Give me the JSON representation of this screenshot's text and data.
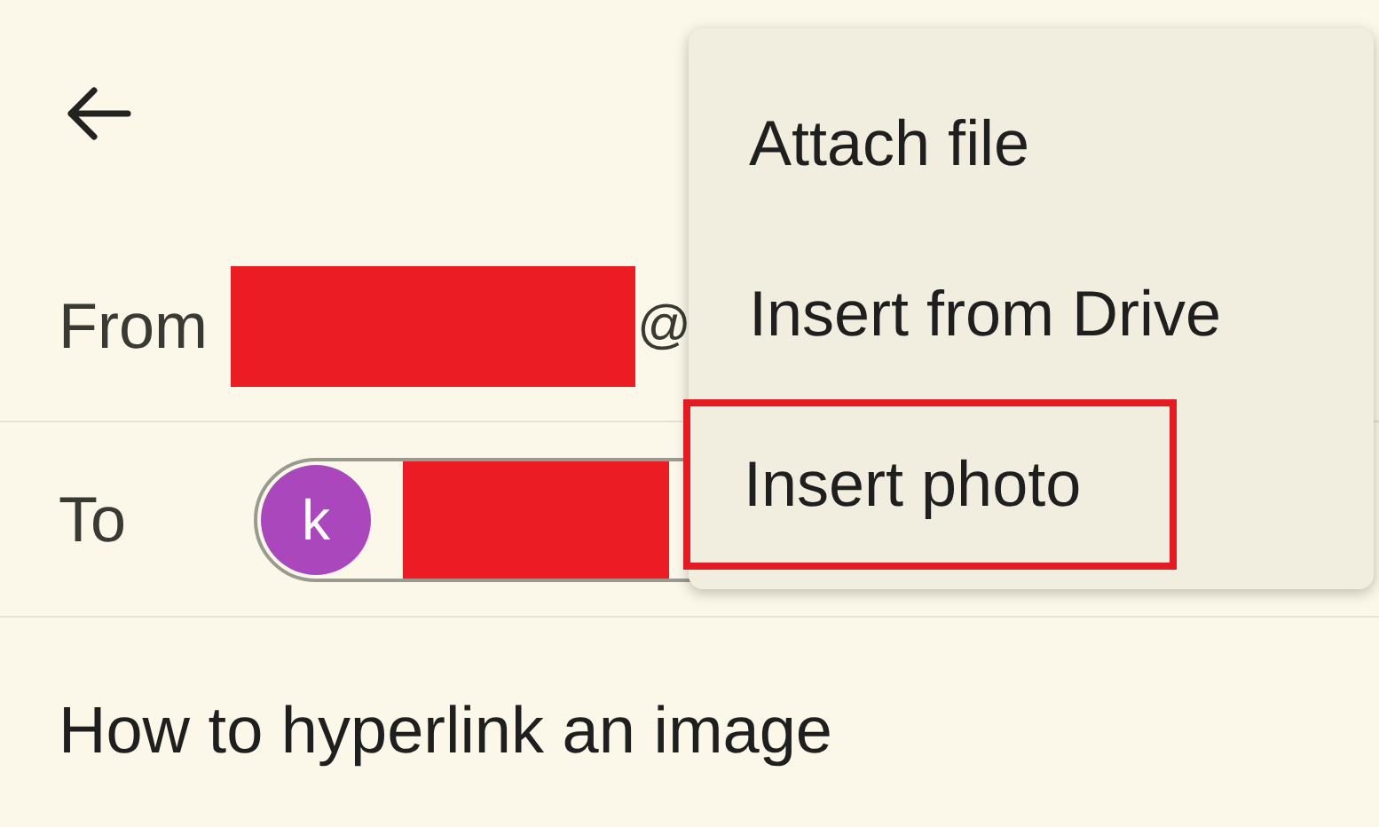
{
  "from": {
    "label": "From",
    "redacted": true,
    "suffix": "@"
  },
  "to": {
    "label": "To",
    "chip": {
      "initial": "k",
      "color": "#ab47bc",
      "redacted": true
    }
  },
  "subject": {
    "value": "How to hyperlink an image"
  },
  "menu": {
    "items": [
      {
        "label": "Attach file",
        "highlighted": false
      },
      {
        "label": "Insert from Drive",
        "highlighted": false
      },
      {
        "label": "Insert photo",
        "highlighted": true
      }
    ]
  }
}
